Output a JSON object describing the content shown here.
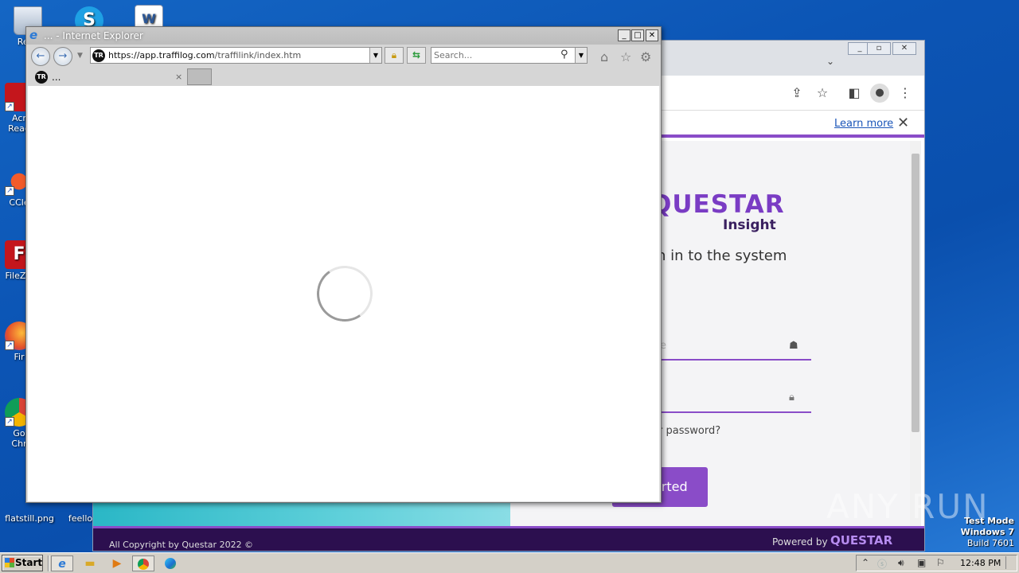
{
  "desktop": {
    "icons": [
      {
        "label": "Recy",
        "icon": "recycle-bin-icon"
      },
      {
        "label": "Acr\nRead",
        "icon": "acrobat-reader-icon"
      },
      {
        "label": "CCle",
        "icon": "ccleaner-icon"
      },
      {
        "label": "FileZill",
        "icon": "filezilla-icon"
      },
      {
        "label": "Fir",
        "icon": "firefox-icon"
      },
      {
        "label": "Go\nChr",
        "icon": "google-chrome-icon"
      },
      {
        "label": "flatstill.png",
        "icon": "image-file-icon"
      },
      {
        "label": "feello",
        "icon": "file-icon"
      }
    ]
  },
  "chrome": {
    "learn_more": "Learn more",
    "logo_text": "QUESTAR",
    "logo_sub": "Insight",
    "signin_text": "n in to the system",
    "username_placeholder": "e",
    "forgot_text": "r password?",
    "get_started": "arted",
    "copyright": "All Copyright by Questar 2022 ©",
    "powered_by": "Powered by",
    "footer_logo": "QUESTAR"
  },
  "ie": {
    "title": "... - Internet Explorer",
    "url_main": "https://app.traffilog.com",
    "url_rest": "/traffilink/index.htm",
    "favicon_text": "TR",
    "search_placeholder": "Search...",
    "tab_title": "...",
    "tab_close": "×"
  },
  "watermark": "ANY RUN",
  "system": {
    "test_mode": "Test Mode",
    "os_name": "Windows 7",
    "build": "Build 7601",
    "clock": "12:48 PM"
  },
  "taskbar": {
    "start_label": "Start"
  }
}
